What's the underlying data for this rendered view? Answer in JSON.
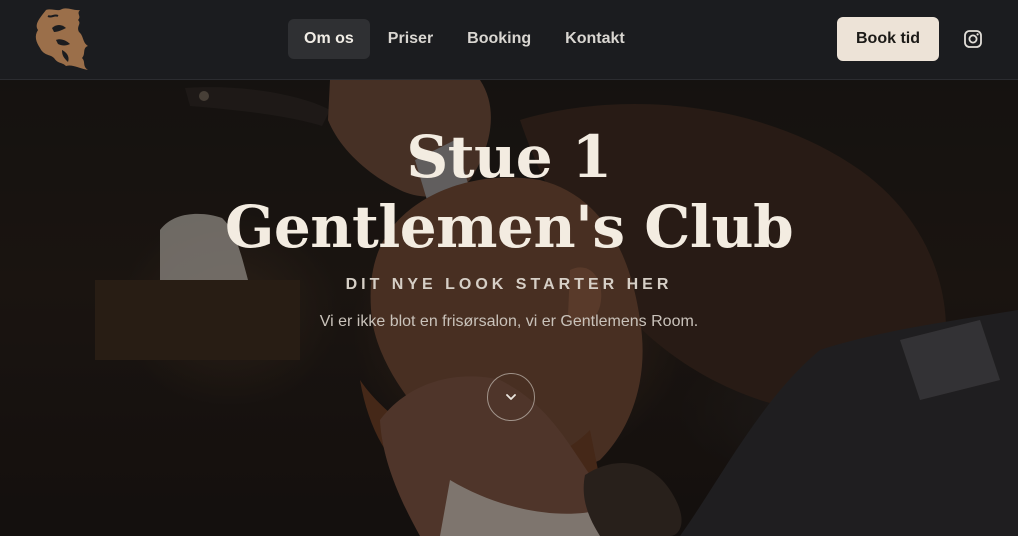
{
  "header": {
    "logo_alt": "Stue 1 Gentlemen's Club logo",
    "nav": [
      {
        "label": "Om os",
        "active": true
      },
      {
        "label": "Priser",
        "active": false
      },
      {
        "label": "Booking",
        "active": false
      },
      {
        "label": "Kontakt",
        "active": false
      }
    ],
    "book_button": "Book tid",
    "social_icon": "instagram-icon"
  },
  "hero": {
    "title_line1": "Stue 1",
    "title_line2": "Gentlemen's Club",
    "tagline": "DIT NYE LOOK STARTER HER",
    "subtitle": "Vi er ikke blot en frisørsalon, vi er Gentlemens Room.",
    "scroll_icon": "chevron-down-icon",
    "background": "barber shaving a man's beard with a straight razor"
  },
  "colors": {
    "header_bg": "#1b1c1f",
    "accent_button": "#ede3d7",
    "logo_brown": "#9b6f4a",
    "title_text": "#f3ece1"
  }
}
